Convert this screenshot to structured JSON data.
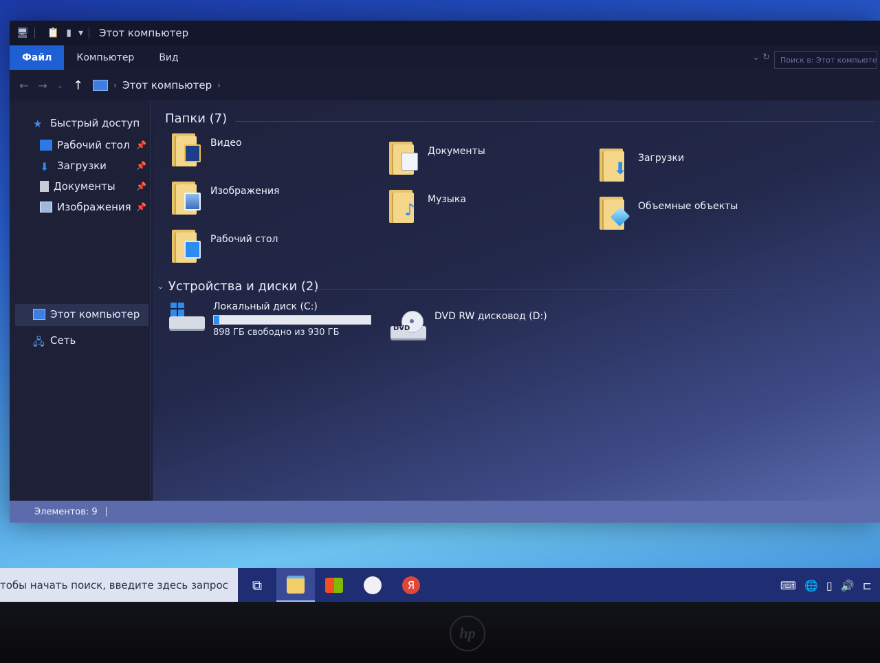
{
  "window": {
    "title": "Этот компьютер",
    "tabs": [
      "Файл",
      "Компьютер",
      "Вид"
    ]
  },
  "address": {
    "path": "Этот компьютер",
    "search_placeholder": "Поиск в: Этот компьютер"
  },
  "nav": {
    "quick_access": "Быстрый доступ",
    "items": [
      {
        "label": "Рабочий стол",
        "pinned": true
      },
      {
        "label": "Загрузки",
        "pinned": true
      },
      {
        "label": "Документы",
        "pinned": true
      },
      {
        "label": "Изображения",
        "pinned": true
      }
    ],
    "this_pc": "Этот компьютер",
    "network": "Сеть"
  },
  "folders": {
    "header": "Папки (7)",
    "items": [
      {
        "label": "Видео",
        "icon": "video-folder-icon"
      },
      {
        "label": "Документы",
        "icon": "documents-folder-icon"
      },
      {
        "label": "Загрузки",
        "icon": "downloads-folder-icon"
      },
      {
        "label": "Изображения",
        "icon": "pictures-folder-icon"
      },
      {
        "label": "Музыка",
        "icon": "music-folder-icon"
      },
      {
        "label": "Объемные объекты",
        "icon": "3d-objects-folder-icon"
      },
      {
        "label": "Рабочий стол",
        "icon": "desktop-folder-icon"
      }
    ]
  },
  "devices": {
    "header": "Устройства и диски (2)",
    "drives": [
      {
        "name": "Локальный диск (C:)",
        "free_text": "898 ГБ свободно из 930 ГБ",
        "used_fraction": 0.035
      },
      {
        "name": "DVD RW дисковод (D:)",
        "badge": "DVD"
      }
    ]
  },
  "status": {
    "items_count": "Элементов: 9"
  },
  "taskbar": {
    "search_text": "тобы начать поиск, введите здесь запрос",
    "yandex_letter": "Я"
  },
  "brand": "hp",
  "colors": {
    "accent": "#1e5fd4",
    "folder": "#f4d78a",
    "drive_bar": "#2b8ef0"
  }
}
